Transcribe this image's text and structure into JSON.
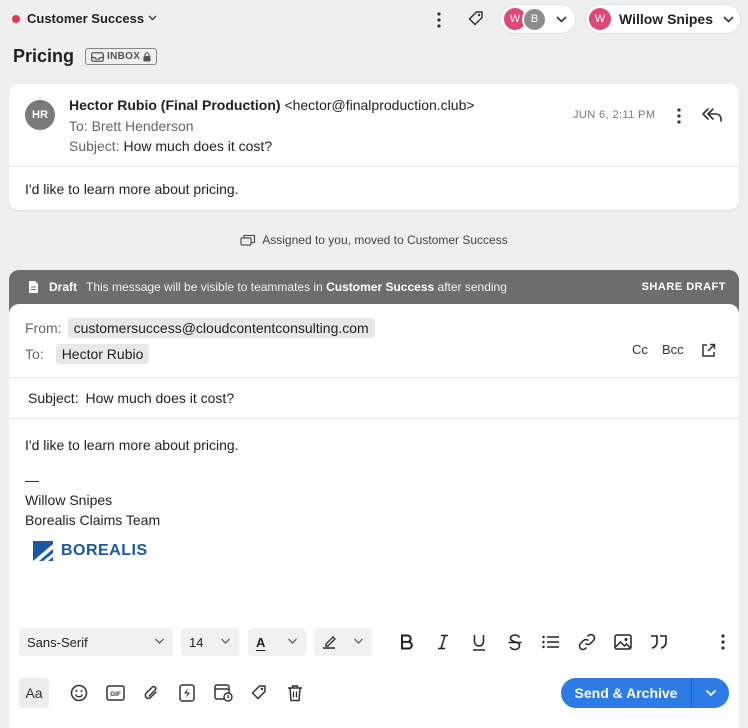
{
  "topbar": {
    "team_name": "Customer Success",
    "team_dot_color": "#e3384f",
    "participants": [
      {
        "initial": "W",
        "color": "#e0457b"
      },
      {
        "initial": "B",
        "color": "#8d8d8d"
      }
    ],
    "user": {
      "initial": "W",
      "name": "Willow Snipes",
      "color": "#e0457b"
    }
  },
  "conversation": {
    "title": "Pricing",
    "badge": "INBOX"
  },
  "message": {
    "avatar_initials": "HR",
    "from_name": "Hector Rubio (Final Production)",
    "from_email": "<hector@finalproduction.club>",
    "to_line": "To: Brett Henderson",
    "subject_label": "Subject:",
    "subject": "How much does it cost?",
    "date": "JUN 6, 2:11 PM",
    "body": "I'd like to learn more about pricing."
  },
  "event": {
    "text": "Assigned to you, moved to Customer Success"
  },
  "draft": {
    "label": "Draft",
    "note_prefix": "This message will be visible to teammates in",
    "note_team": "Customer Success",
    "note_suffix": "after sending",
    "share_label": "SHARE DRAFT",
    "from_label": "From:",
    "from_value": "customersuccess@cloudcontentconsulting.com",
    "to_label": "To:",
    "to_value": "Hector Rubio",
    "cc_label": "Cc",
    "bcc_label": "Bcc",
    "subject_label": "Subject:",
    "subject_value": "How much does it cost?",
    "body_line": "I'd like to learn more about pricing.",
    "sig_dash": "—",
    "sig_name": "Willow Snipes",
    "sig_team": "Borealis Claims Team",
    "logo_text": "BOREALIS",
    "brand_color": "#1a58a8"
  },
  "toolbar": {
    "font_family": "Sans-Serif",
    "font_size": "14",
    "text_color_glyph": "A",
    "aa_label": "Aa",
    "send_label": "Send & Archive",
    "send_color": "#2d7be5"
  }
}
